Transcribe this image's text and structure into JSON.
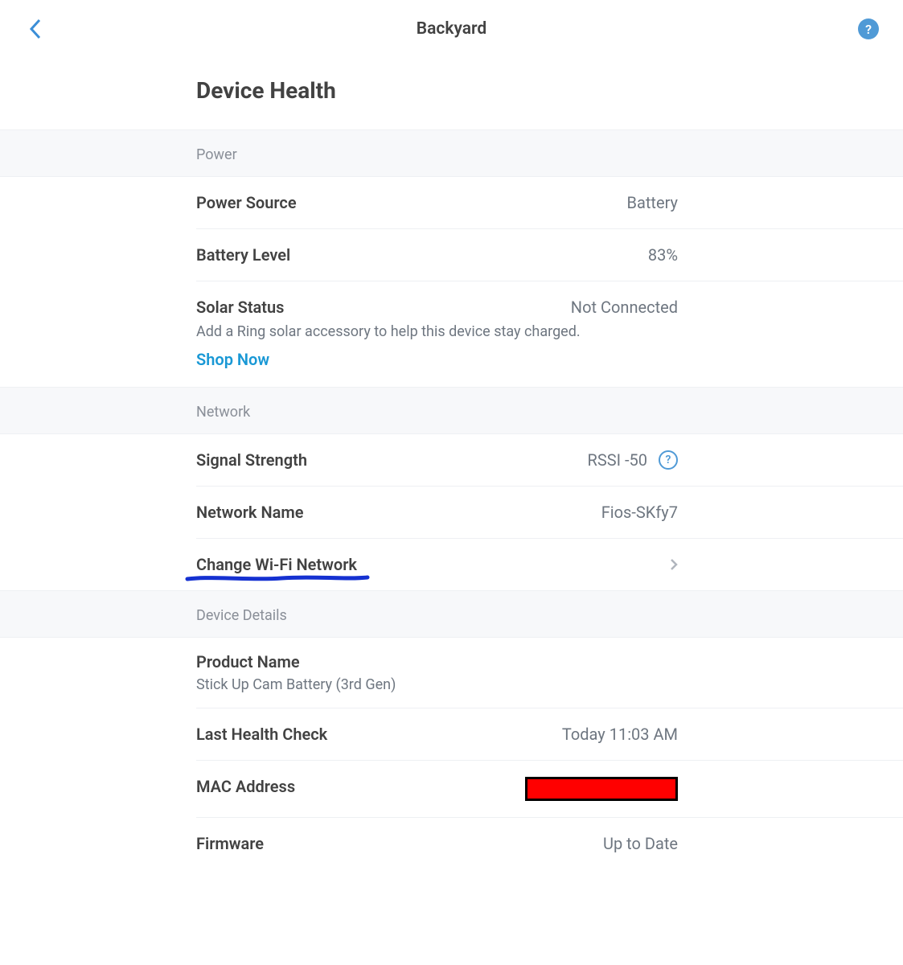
{
  "header": {
    "title": "Backyard"
  },
  "page_title": "Device Health",
  "sections": {
    "power": {
      "header": "Power",
      "power_source": {
        "label": "Power Source",
        "value": "Battery"
      },
      "battery_level": {
        "label": "Battery Level",
        "value": "83%"
      },
      "solar_status": {
        "label": "Solar Status",
        "value": "Not Connected",
        "description": "Add a Ring solar accessory to help this device stay charged.",
        "link": "Shop Now"
      }
    },
    "network": {
      "header": "Network",
      "signal_strength": {
        "label": "Signal Strength",
        "value": "RSSI -50"
      },
      "network_name": {
        "label": "Network Name",
        "value": "Fios-SKfy7"
      },
      "change_wifi": {
        "label": "Change Wi-Fi Network"
      }
    },
    "device_details": {
      "header": "Device Details",
      "product_name": {
        "label": "Product Name",
        "value": "Stick Up Cam Battery (3rd Gen)"
      },
      "last_health_check": {
        "label": "Last Health Check",
        "value": "Today 11:03 AM"
      },
      "mac_address": {
        "label": "MAC Address",
        "value_redacted": true
      },
      "firmware": {
        "label": "Firmware",
        "value": "Up to Date"
      }
    }
  }
}
